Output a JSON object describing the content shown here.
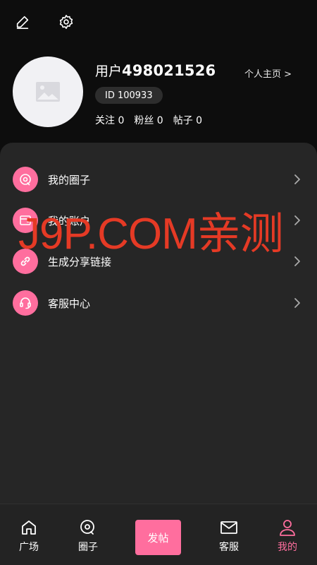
{
  "header": {
    "edit_icon": "edit-icon",
    "settings_icon": "gear-icon"
  },
  "profile": {
    "username_prefix": "用户",
    "username_number": "498021526",
    "homepage_link": "个人主页 >",
    "id_badge": "ID 100933",
    "stats": {
      "following": "关注 0",
      "followers": "粉丝 0",
      "posts": "帖子 0"
    }
  },
  "menu": [
    {
      "label": "我的圈子",
      "icon": "circle-icon"
    },
    {
      "label": "我的账户",
      "icon": "wallet-icon"
    },
    {
      "label": "生成分享链接",
      "icon": "link-icon"
    },
    {
      "label": "客服中心",
      "icon": "headset-icon"
    }
  ],
  "watermark": "J9P.COM亲测",
  "tabbar": {
    "square": "广场",
    "circle": "圈子",
    "post": "发帖",
    "service": "客服",
    "mine": "我的"
  },
  "colors": {
    "accent": "#ff6e9e",
    "background": "#0d0d0d",
    "panel": "#262626",
    "watermark": "#e53a25"
  }
}
